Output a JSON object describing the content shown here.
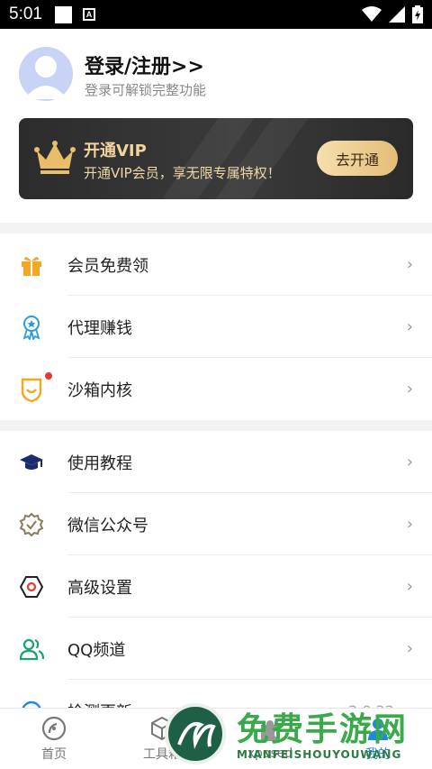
{
  "status_bar": {
    "time": "5:01",
    "notification_letter": "A"
  },
  "profile": {
    "title": "登录/注册>>",
    "subtitle": "登录可解锁完整功能"
  },
  "vip": {
    "title": "开通VIP",
    "subtitle": "开通VIP会员，享无限专属特权！",
    "button": "去开通"
  },
  "menu_group_1": [
    {
      "label": "会员免费领",
      "icon": "gift-icon",
      "color": "#f5a623"
    },
    {
      "label": "代理赚钱",
      "icon": "medal-icon",
      "color": "#2b9ed8"
    },
    {
      "label": "沙箱内核",
      "icon": "shield-icon",
      "color": "#f5a623",
      "badge": true
    }
  ],
  "menu_group_2": [
    {
      "label": "使用教程",
      "icon": "graduation-cap-icon",
      "color": "#1a2d6b"
    },
    {
      "label": "微信公众号",
      "icon": "badge-check-icon",
      "color": "#8a7d5a"
    },
    {
      "label": "高级设置",
      "icon": "hexagon-settings-icon",
      "color": "#e53935"
    },
    {
      "label": "QQ频道",
      "icon": "users-icon",
      "color": "#1aa36f"
    },
    {
      "label": "检测更新",
      "icon": "refresh-icon",
      "color": "#1e88e5",
      "value": "2.0.22"
    }
  ],
  "tabs": [
    {
      "label": "首页",
      "icon": "home-disc-icon",
      "active": false
    },
    {
      "label": "工具箱",
      "icon": "cube-icon",
      "active": false
    },
    {
      "label": "xposed",
      "icon": "puzzle-icon",
      "active": false
    },
    {
      "label": "我的",
      "icon": "person-icon",
      "active": true
    }
  ],
  "watermark": {
    "text": "免费手游网",
    "sub": "MIANFEISHOUYOUWANG"
  },
  "colors": {
    "vip_gold": "#f3d59b",
    "accent_blue": "#1e88e5",
    "badge_red": "#e53935"
  }
}
